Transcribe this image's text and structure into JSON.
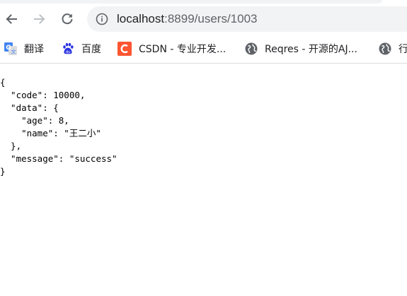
{
  "toolbar": {
    "url_host": "localhost",
    "url_rest": ":8899/users/1003"
  },
  "bookmarks": [
    {
      "label": "翻译",
      "icon": "google-translate-icon"
    },
    {
      "label": "百度",
      "icon": "baidu-paw-icon"
    },
    {
      "label": "CSDN - 专业开发...",
      "icon": "csdn-icon"
    },
    {
      "label": "Reqres - 开源的AJ...",
      "icon": "globe-icon"
    },
    {
      "label": "行",
      "icon": "globe-icon"
    }
  ],
  "json_lines": [
    "{",
    "  \"code\": 10000,",
    "  \"data\": {",
    "    \"age\": 8,",
    "    \"name\": \"王二小\"",
    "  },",
    "  \"message\": \"success\"",
    "}"
  ],
  "colors": {
    "omnibox_bg": "#f1f3f4",
    "text": "#202124",
    "icon": "#5f6368",
    "csdn_red": "#fc5531",
    "baidu_blue": "#2932e1",
    "translate_blue": "#4285f4"
  }
}
